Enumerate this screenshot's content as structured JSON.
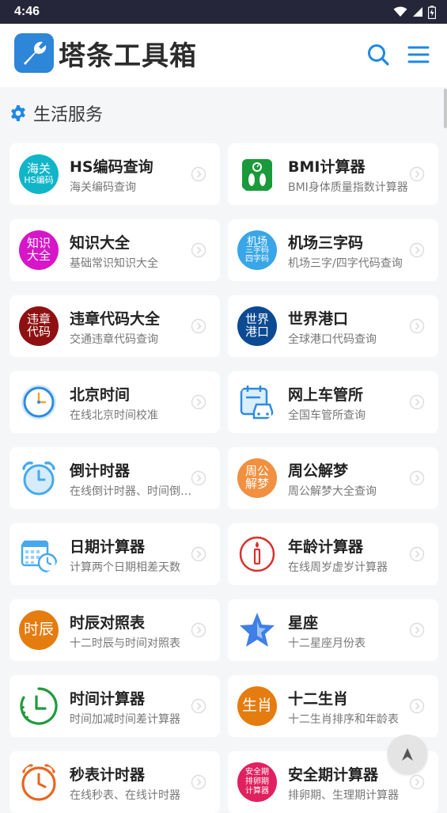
{
  "status": {
    "time": "4:46"
  },
  "header": {
    "brand": "塔条工具箱"
  },
  "section": {
    "title": "生活服务"
  },
  "cards": [
    {
      "title": "HS编码查询",
      "sub": "海关编码查询",
      "icon": "hs-code-icon",
      "icon_text": [
        "海关",
        "HS编码"
      ]
    },
    {
      "title": "BMI计算器",
      "sub": "BMI身体质量指数计算器",
      "icon": "bmi-scale-icon"
    },
    {
      "title": "知识大全",
      "sub": "基础常识知识大全",
      "icon": "knowledge-icon",
      "icon_text": [
        "知识",
        "大全"
      ]
    },
    {
      "title": "机场三字码",
      "sub": "机场三字/四字代码查询",
      "icon": "airport-code-icon",
      "icon_text": [
        "机场",
        "三字码",
        "四字码"
      ]
    },
    {
      "title": "违章代码大全",
      "sub": "交通违章代码查询",
      "icon": "violation-code-icon",
      "icon_text": [
        "违章",
        "代码"
      ]
    },
    {
      "title": "世界港口",
      "sub": "全球港口代码查询",
      "icon": "world-port-icon",
      "icon_text": [
        "世界",
        "港口"
      ]
    },
    {
      "title": "北京时间",
      "sub": "在线北京时间校准",
      "icon": "clock-icon"
    },
    {
      "title": "网上车管所",
      "sub": "全国车管所查询",
      "icon": "car-calendar-icon"
    },
    {
      "title": "倒计时器",
      "sub": "在线倒计时器、时间倒计时",
      "icon": "alarm-clock-icon"
    },
    {
      "title": "周公解梦",
      "sub": "周公解梦大全查询",
      "icon": "dream-icon",
      "icon_text": [
        "周公",
        "解梦"
      ]
    },
    {
      "title": "日期计算器",
      "sub": "计算两个日期相差天数",
      "icon": "date-calendar-icon"
    },
    {
      "title": "年龄计算器",
      "sub": "在线周岁虚岁计算器",
      "icon": "age-candle-icon"
    },
    {
      "title": "时辰对照表",
      "sub": "十二时辰与时间对照表",
      "icon": "shichen-icon",
      "icon_text": [
        "时辰"
      ]
    },
    {
      "title": "星座",
      "sub": "十二星座月份表",
      "icon": "star-icon"
    },
    {
      "title": "时间计算器",
      "sub": "时间加减时间差计算器",
      "icon": "time-calc-icon"
    },
    {
      "title": "十二生肖",
      "sub": "十二生肖排序和年龄表",
      "icon": "zodiac-icon",
      "icon_text": [
        "生肖"
      ]
    },
    {
      "title": "秒表计时器",
      "sub": "在线秒表、在线计时器",
      "icon": "stopwatch-icon"
    },
    {
      "title": "安全期计算器",
      "sub": "排卵期、生理期计算器",
      "icon": "safe-period-icon",
      "icon_text": [
        "安全期",
        "排卵期",
        "计算器"
      ]
    }
  ],
  "colors": {
    "accent": "#1e88e5",
    "card_bg": "#ffffff",
    "page_bg": "#f5f6f8"
  }
}
